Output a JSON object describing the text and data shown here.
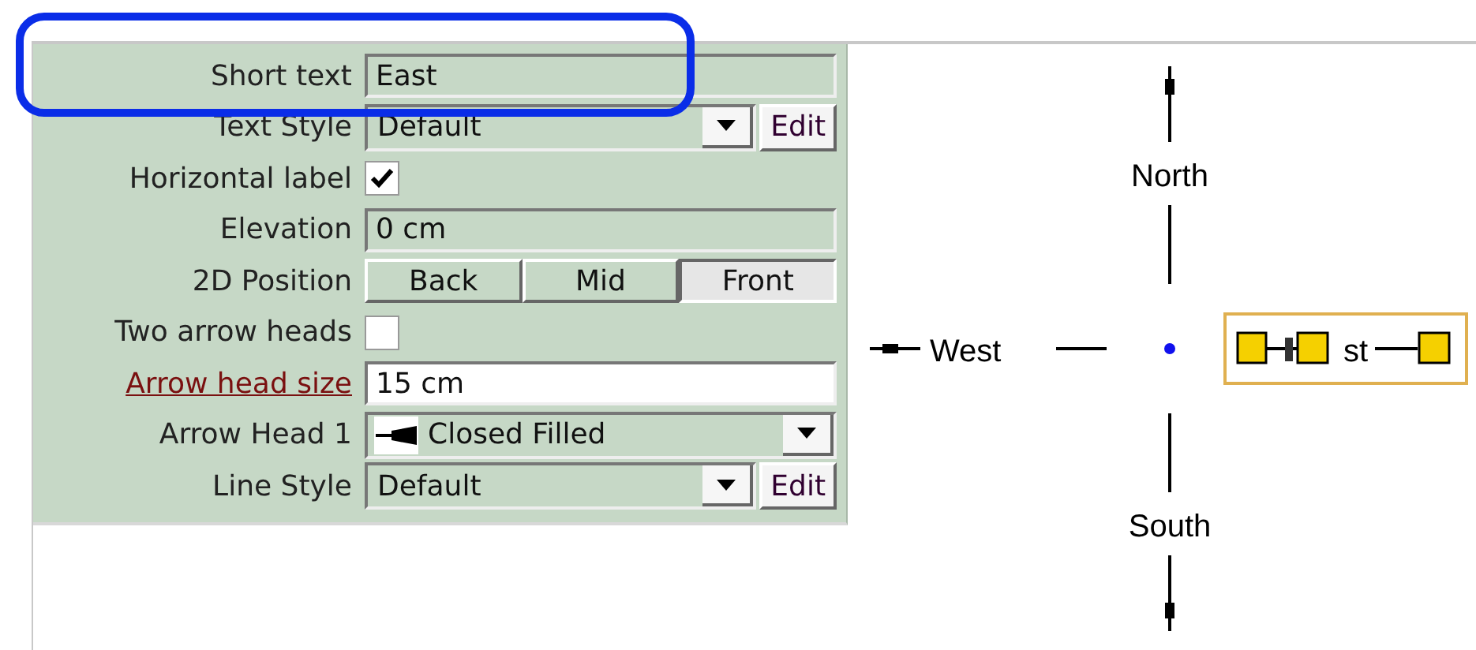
{
  "properties": [
    {
      "kind": "text",
      "label": "Short text",
      "label_link": false,
      "value": "East",
      "editable": false
    },
    {
      "kind": "select_edit",
      "label": "Text Style",
      "label_link": false,
      "value": "Default",
      "button": "Edit"
    },
    {
      "kind": "checkbox",
      "label": "Horizontal label",
      "label_link": false,
      "checked": true
    },
    {
      "kind": "text",
      "label": "Elevation",
      "label_link": false,
      "value": "0 cm",
      "editable": false
    },
    {
      "kind": "segmented",
      "label": "2D Position",
      "label_link": false,
      "options": [
        {
          "label": "Back",
          "selected": false
        },
        {
          "label": "Mid",
          "selected": false
        },
        {
          "label": "Front",
          "selected": true
        }
      ]
    },
    {
      "kind": "checkbox",
      "label": "Two arrow heads",
      "label_link": false,
      "checked": false
    },
    {
      "kind": "text",
      "label": "Arrow head size",
      "label_link": true,
      "value": "15 cm",
      "editable": true
    },
    {
      "kind": "select_icon",
      "label": "Arrow Head 1",
      "label_link": false,
      "value": "Closed Filled"
    },
    {
      "kind": "select_edit",
      "label": "Line Style",
      "label_link": false,
      "value": "Default",
      "button": "Edit"
    }
  ],
  "diagram": {
    "north": "North",
    "south": "South",
    "west": "West",
    "east_visible": "st"
  }
}
